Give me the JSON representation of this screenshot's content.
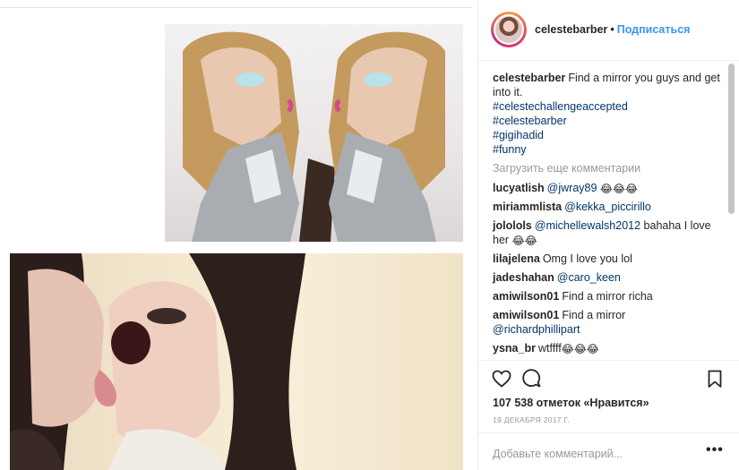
{
  "post": {
    "username": "celestebarber",
    "dot": "•",
    "follow_label": "Подписаться",
    "caption_text": "Find a mirror you guys and get into it.",
    "hashtags": [
      "#celestechallengeaccepted",
      "#celestebarber",
      "#gigihadid",
      "#funny"
    ],
    "load_more": "Загрузить еще комментарии",
    "likes": "107 538 отметок «Нравится»",
    "date": "19 ДЕКАБРЯ 2017 Г.",
    "add_comment_placeholder": "Добавьте комментарий...",
    "more_icon": "•••"
  },
  "comments": [
    {
      "user": "lucyatlish",
      "mention": "@jwray89",
      "text": "",
      "emoji": "😂😂😂"
    },
    {
      "user": "miriammlista",
      "mention": "@kekka_piccirillo",
      "text": "",
      "emoji": ""
    },
    {
      "user": "jololols",
      "mention": "@michellewalsh2012",
      "text": "bahaha I love her",
      "emoji": "😂😂"
    },
    {
      "user": "lilajelena",
      "mention": "",
      "text": "Omg I love you lol",
      "emoji": ""
    },
    {
      "user": "jadeshahan",
      "mention": "@caro_keen",
      "text": "",
      "emoji": ""
    },
    {
      "user": "amiwilson01",
      "mention": "",
      "text": "Find a mirror richa",
      "emoji": ""
    },
    {
      "user": "amiwilson01",
      "mention": "@richardphillipart",
      "text": "Find a mirror",
      "emoji": "",
      "text_first": true
    },
    {
      "user": "ysna_br",
      "mention": "",
      "text": "wtffff",
      "emoji": "😂😂😂"
    }
  ],
  "icons": {
    "like": "heart-icon",
    "comment": "comment-icon",
    "save": "bookmark-icon"
  },
  "colors": {
    "link": "#3897f0",
    "mention": "#003569",
    "muted": "#999999",
    "text": "#262626"
  }
}
